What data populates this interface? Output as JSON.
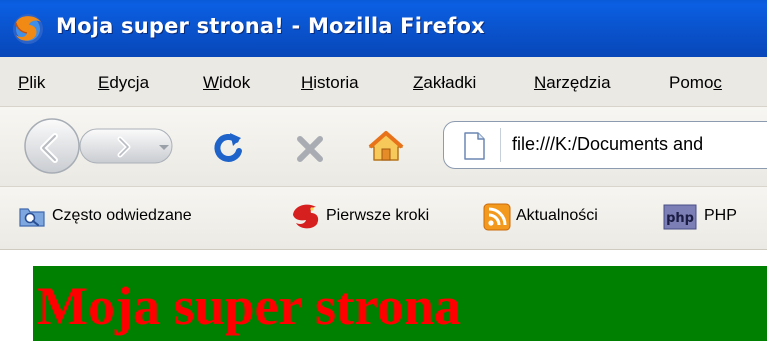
{
  "window": {
    "title": "Moja super strona! - Mozilla Firefox"
  },
  "menubar": {
    "items": [
      {
        "label": "Plik",
        "accel": "P",
        "rest": "lik"
      },
      {
        "label": "Edycja",
        "accel": "E",
        "rest": "dycja"
      },
      {
        "label": "Widok",
        "accel": "W",
        "rest": "idok"
      },
      {
        "label": "Historia",
        "accel": "H",
        "rest": "istoria"
      },
      {
        "label": "Zakładki",
        "accel": "Z",
        "rest": "akładki"
      },
      {
        "label": "Narzędzia",
        "accel": "N",
        "rest": "arzędzia"
      },
      {
        "label": "Pomoc",
        "pre": "Pomo",
        "accel": "c"
      }
    ]
  },
  "navbar": {
    "url": "file:///K:/Documents and"
  },
  "bookmarks": {
    "items": [
      {
        "label": "Często odwiedzane",
        "icon": "search-folder-icon"
      },
      {
        "label": "Pierwsze kroki",
        "icon": "firefox-red-icon"
      },
      {
        "label": "Aktualności",
        "icon": "rss-feed-icon"
      },
      {
        "label": "PHP",
        "icon": "php-icon"
      }
    ]
  },
  "page": {
    "heading": "Moja super strona",
    "banner_color": "#008000",
    "heading_color": "#ff0000"
  }
}
